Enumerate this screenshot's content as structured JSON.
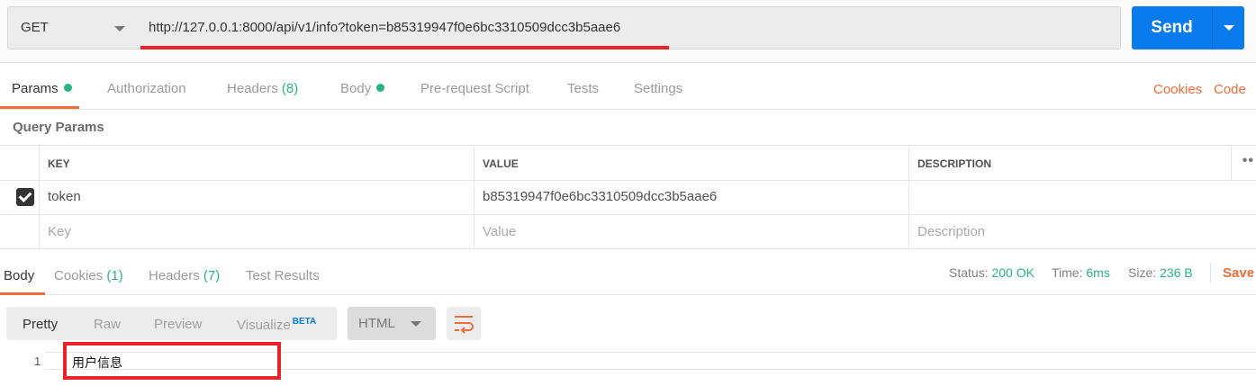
{
  "request": {
    "method": "GET",
    "url": "http://127.0.0.1:8000/api/v1/info?token=b85319947f0e6bc3310509dcc3b5aae6",
    "send_label": "Send"
  },
  "request_tabs": [
    {
      "label": "Params",
      "active": true,
      "dot": true
    },
    {
      "label": "Authorization"
    },
    {
      "label": "Headers",
      "count": "(8)"
    },
    {
      "label": "Body",
      "dot": true
    },
    {
      "label": "Pre-request Script"
    },
    {
      "label": "Tests"
    },
    {
      "label": "Settings"
    }
  ],
  "request_links": {
    "cookies": "Cookies",
    "code": "Code"
  },
  "query_params": {
    "title": "Query Params",
    "headers": {
      "key": "KEY",
      "value": "VALUE",
      "description": "DESCRIPTION"
    },
    "rows": [
      {
        "checked": true,
        "key": "token",
        "value": "b85319947f0e6bc3310509dcc3b5aae6",
        "description": ""
      }
    ],
    "placeholders": {
      "key": "Key",
      "value": "Value",
      "description": "Description"
    }
  },
  "response_tabs": [
    {
      "label": "Body",
      "active": true
    },
    {
      "label": "Cookies",
      "count": "(1)"
    },
    {
      "label": "Headers",
      "count": "(7)"
    },
    {
      "label": "Test Results"
    }
  ],
  "response_status": {
    "status_label": "Status:",
    "status_value": "200 OK",
    "time_label": "Time:",
    "time_value": "6ms",
    "size_label": "Size:",
    "size_value": "236 B",
    "save_label": "Save"
  },
  "view_options": {
    "pretty": "Pretty",
    "raw": "Raw",
    "preview": "Preview",
    "visualize": "Visualize",
    "beta": "BETA",
    "format": "HTML"
  },
  "response_body": {
    "line_number": "1",
    "content": "用户信息"
  },
  "colors": {
    "accent": "#f26b3a",
    "send": "#097bed",
    "success": "#26b47f",
    "annotation": "#e8232a"
  }
}
